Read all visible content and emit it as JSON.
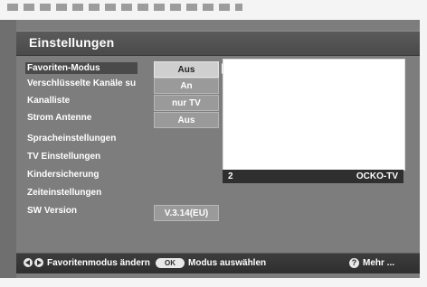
{
  "title": "Einstellungen",
  "menu": [
    {
      "label": "Favoriten-Modus",
      "value": "Aus"
    },
    {
      "label": "Verschlüsselte Kanäle su",
      "value": "An"
    },
    {
      "label": "Kanalliste",
      "value": "nur TV"
    },
    {
      "label": "Strom Antenne",
      "value": "Aus"
    },
    {
      "label": "Spracheinstellungen",
      "value": ""
    },
    {
      "label": "TV Einstellungen",
      "value": ""
    },
    {
      "label": "Kindersicherung",
      "value": ""
    },
    {
      "label": "Zeiteinstellungen",
      "value": ""
    },
    {
      "label": "SW Version",
      "value": "V.3.14(EU)"
    }
  ],
  "selected_index": 0,
  "channel": {
    "number": "2",
    "name": "OCKO-TV"
  },
  "footer": {
    "left_hint": "Favoritenmodus ändern",
    "ok_label": "OK",
    "ok_hint": "Modus auswählen",
    "help_label": "?",
    "more_hint": "Mehr ..."
  }
}
